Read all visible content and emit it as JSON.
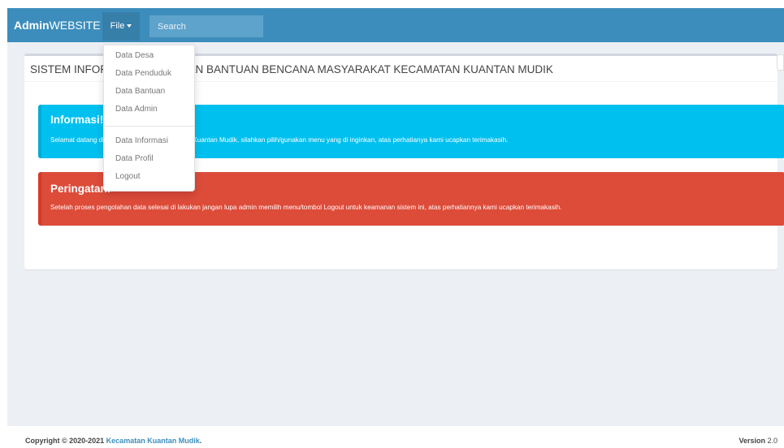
{
  "navbar": {
    "brand_bold": "Admin",
    "brand_rest": "WEBSITE",
    "file_label": "File",
    "search_placeholder": "Search"
  },
  "dropdown": {
    "items": [
      "Data Desa",
      "Data Penduduk",
      "Data Bantuan",
      "Data Admin",
      "Data Informasi",
      "Data Profil",
      "Logout"
    ]
  },
  "box": {
    "title": "SISTEM INFORMASI PENDATAAN BANTUAN BENCANA MASYARAKAT KECAMATAN KUANTAN MUDIK"
  },
  "alerts": {
    "info_title": "Informasi!",
    "info_text": "Selamat datang di Sistem Informasi Kecamatan Kuantan Mudik, silahkan pilih/gunakan menu yang di inginkan, atas perhatianya kami ucapkan terimakasih.",
    "danger_title": "Peringatan!",
    "danger_text": "Setelah proses pengolahan data selesai di lakukan jangan lupa admin memilih menu/tombol Logout untuk keamanan sistem ini, atas perhatiannya kami ucapkan terimakasih."
  },
  "footer": {
    "copyright_prefix": "Copyright © 2020-2021 ",
    "copyright_link": "Kecamatan Kuantan Mudik",
    "copyright_suffix": ".",
    "version_label": "Version",
    "version_number": " 2.0"
  },
  "colors": {
    "navbar": "#3c8dbc",
    "info": "#00c0ef",
    "danger": "#dd4b39"
  }
}
